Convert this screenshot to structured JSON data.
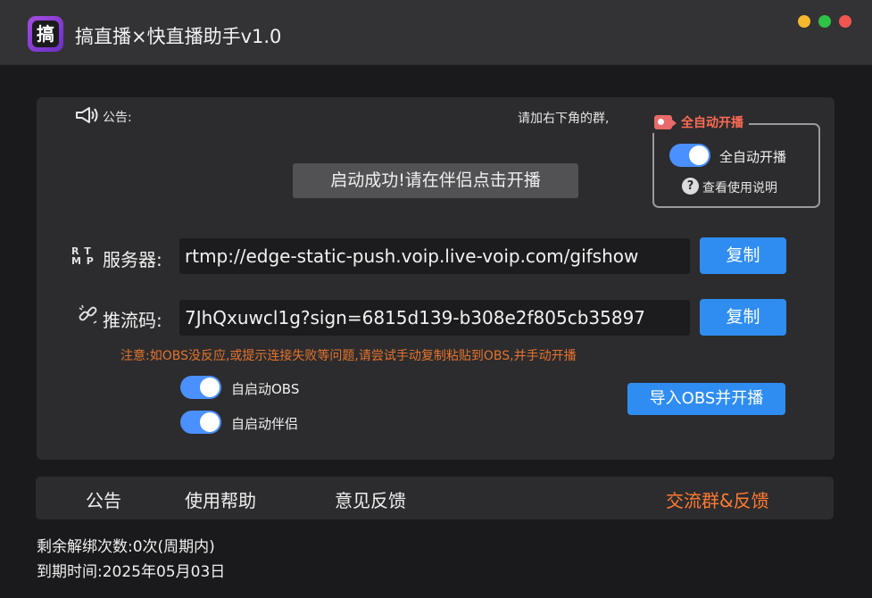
{
  "app": {
    "icon_char": "搞",
    "title": "搞直播×快直播助手v1.0"
  },
  "window_controls": [
    "minimize",
    "maximize",
    "close"
  ],
  "announcement": {
    "label": "公告:",
    "hint": "请加右下角的群,"
  },
  "status_message": "启动成功!请在伴侣点击开播",
  "auto_start": {
    "section_title": "全自动开播",
    "toggle_label": "全自动开播",
    "toggle_on": true,
    "help_link": "查看使用说明"
  },
  "server": {
    "icon_text": "RTMP",
    "label": "服务器:",
    "value": "rtmp://edge-static-push.voip.live-voip.com/gifshow",
    "copy_label": "复制"
  },
  "stream_key": {
    "label": "推流码:",
    "value": "7JhQxuwcl1g?sign=6815d139-b308e2f805cb35897",
    "copy_label": "复制"
  },
  "notice": "注意:如OBS没反应,或提示连接失败等问题,请尝试手动复制粘贴到OBS,并手动开播",
  "options": [
    {
      "label": "自启动OBS",
      "on": true
    },
    {
      "label": "自启动伴侣",
      "on": true
    }
  ],
  "import_button": "导入OBS并开播",
  "bottom_nav": {
    "announcement": "公告",
    "help": "使用帮助",
    "feedback": "意见反馈",
    "group": "交流群&反馈"
  },
  "footer": {
    "remaining": "剩余解绑次数:0次(周期内)",
    "expiry": "到期时间:2025年05月03日"
  },
  "colors": {
    "accent_blue": "#2f8df2",
    "warning_orange": "#e5732d",
    "toggle_blue": "#4a90ff",
    "link_orange": "#ff7a30"
  }
}
